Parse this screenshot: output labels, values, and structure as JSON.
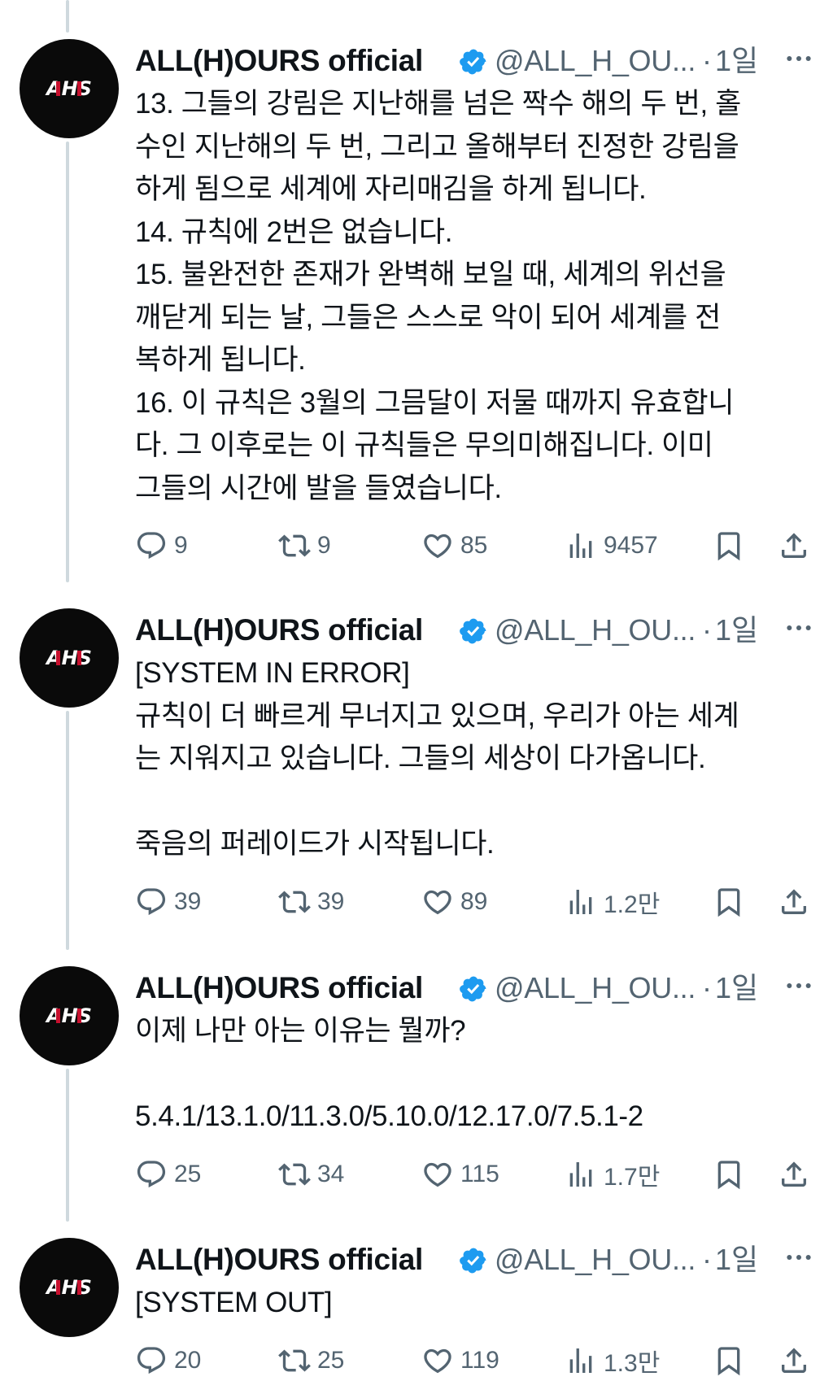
{
  "account": {
    "name": "ALL(H)OURS official",
    "handle": "@ALL_H_OU...",
    "avatar_text": "AHS",
    "verified_color": "#1d9bf0"
  },
  "tweets": [
    {
      "time": "1일",
      "text": "13. 그들의 강림은 지난해를 넘은 짝수 해의 두 번, 홀\n수인 지난해의 두 번, 그리고 올해부터 진정한 강림을\n하게 됨으로 세계에 자리매김을 하게 됩니다.\n14. 규칙에 2번은 없습니다.\n15. 불완전한 존재가 완벽해 보일 때, 세계의 위선을\n깨닫게 되는 날, 그들은 스스로 악이 되어 세계를 전\n복하게 됩니다.\n16. 이 규칙은 3월의 그믐달이 저물 때까지 유효합니\n다. 그 이후로는 이 규칙들은 무의미해집니다. 이미\n그들의 시간에 발을 들였습니다.",
      "replies": "9",
      "retweets": "9",
      "likes": "85",
      "views": "9457"
    },
    {
      "time": "1일",
      "text": "[SYSTEM IN ERROR]\n규칙이 더 빠르게 무너지고 있으며, 우리가 아는 세계\n는 지워지고 있습니다. 그들의 세상이 다가옵니다.\n\n죽음의 퍼레이드가 시작됩니다.",
      "replies": "39",
      "retweets": "39",
      "likes": "89",
      "views": "1.2만"
    },
    {
      "time": "1일",
      "text": "이제 나만 아는 이유는 뭘까?\n\n5.4.1/13.1.0/11.3.0/5.10.0/12.17.0/7.5.1-2",
      "replies": "25",
      "retweets": "34",
      "likes": "115",
      "views": "1.7만"
    },
    {
      "time": "1일",
      "text": "[SYSTEM OUT]",
      "replies": "20",
      "retweets": "25",
      "likes": "119",
      "views": "1.3만"
    }
  ],
  "icons": {
    "verified": "verified-badge-icon",
    "more": "more-options-icon",
    "reply": "reply-icon",
    "retweet": "retweet-icon",
    "like": "like-icon",
    "views": "views-icon",
    "bookmark": "bookmark-icon",
    "share": "share-icon"
  }
}
